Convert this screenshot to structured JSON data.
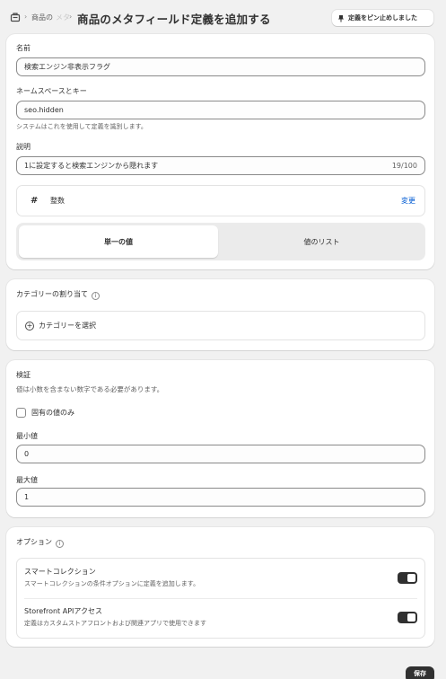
{
  "header": {
    "breadcrumb": "商品の",
    "breadcrumb_fade": "メタ",
    "title": "商品のメタフィールド定義を追加する",
    "pin_label": "定義をピン止めしました"
  },
  "definition": {
    "name_label": "名前",
    "name_value": "検索エンジン非表示フラグ",
    "namespace_label": "ネームスペースとキー",
    "namespace_value": "seo.hidden",
    "namespace_help": "システムはこれを使用して定義を識別します。",
    "description_label": "説明",
    "description_value": "1に設定すると検索エンジンから隠れます",
    "description_counter": "19/100",
    "type_icon": "#",
    "type_label": "整数",
    "change_label": "変更",
    "single_value_label": "単一の値",
    "list_label": "値のリスト"
  },
  "category": {
    "heading": "カテゴリーの割り当て",
    "info_icon": "i",
    "select_label": "カテゴリーを選択"
  },
  "validation": {
    "heading": "検証",
    "note": "値は小数を含まない数字である必要があります。",
    "unique_label": "固有の値のみ",
    "min_label": "最小値",
    "min_value": "0",
    "max_label": "最大値",
    "max_value": "1"
  },
  "options": {
    "heading": "オプション",
    "info_icon": "i",
    "items": [
      {
        "title": "スマートコレクション",
        "desc": "スマートコレクションの条件オプションに定義を追加します。",
        "enabled": true
      },
      {
        "title": "Storefront APIアクセス",
        "desc": "定義はカスタムストアフロントおよび関連アプリで使用できます",
        "enabled": true
      }
    ]
  },
  "footer": {
    "save_label": "保存"
  },
  "colors": {
    "primary": "#303030",
    "link": "#005bd3",
    "background": "#f1f1f1"
  }
}
